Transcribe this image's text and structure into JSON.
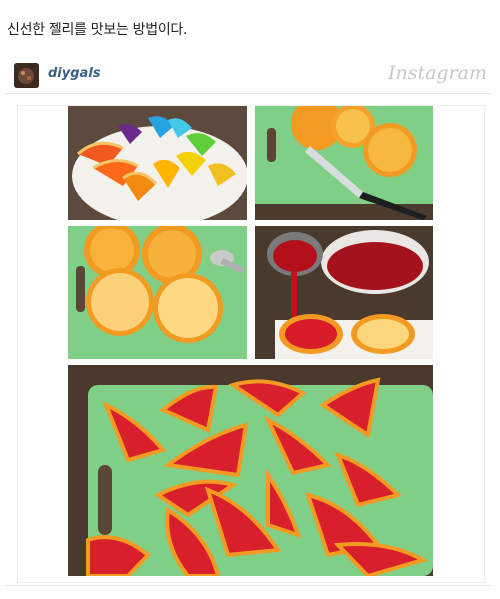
{
  "post": {
    "caption": "신선한 젤리를 맛보는 방법이다."
  },
  "instagram": {
    "username": "diygals",
    "brand": "Instagram"
  },
  "photo": {
    "collage": [
      "rainbow-jelly-wedges",
      "oranges-halved-with-knife",
      "oranges-scooped-hollow",
      "red-jelly-poured-into-peels",
      "red-jelly-orange-wedges"
    ]
  },
  "colors": {
    "board_green": "#7fcf86",
    "orange_peel": "#f39a22",
    "orange_flesh": "#f6b63a",
    "jelly_red": "#d8202c",
    "link_blue": "#3a5f86"
  }
}
